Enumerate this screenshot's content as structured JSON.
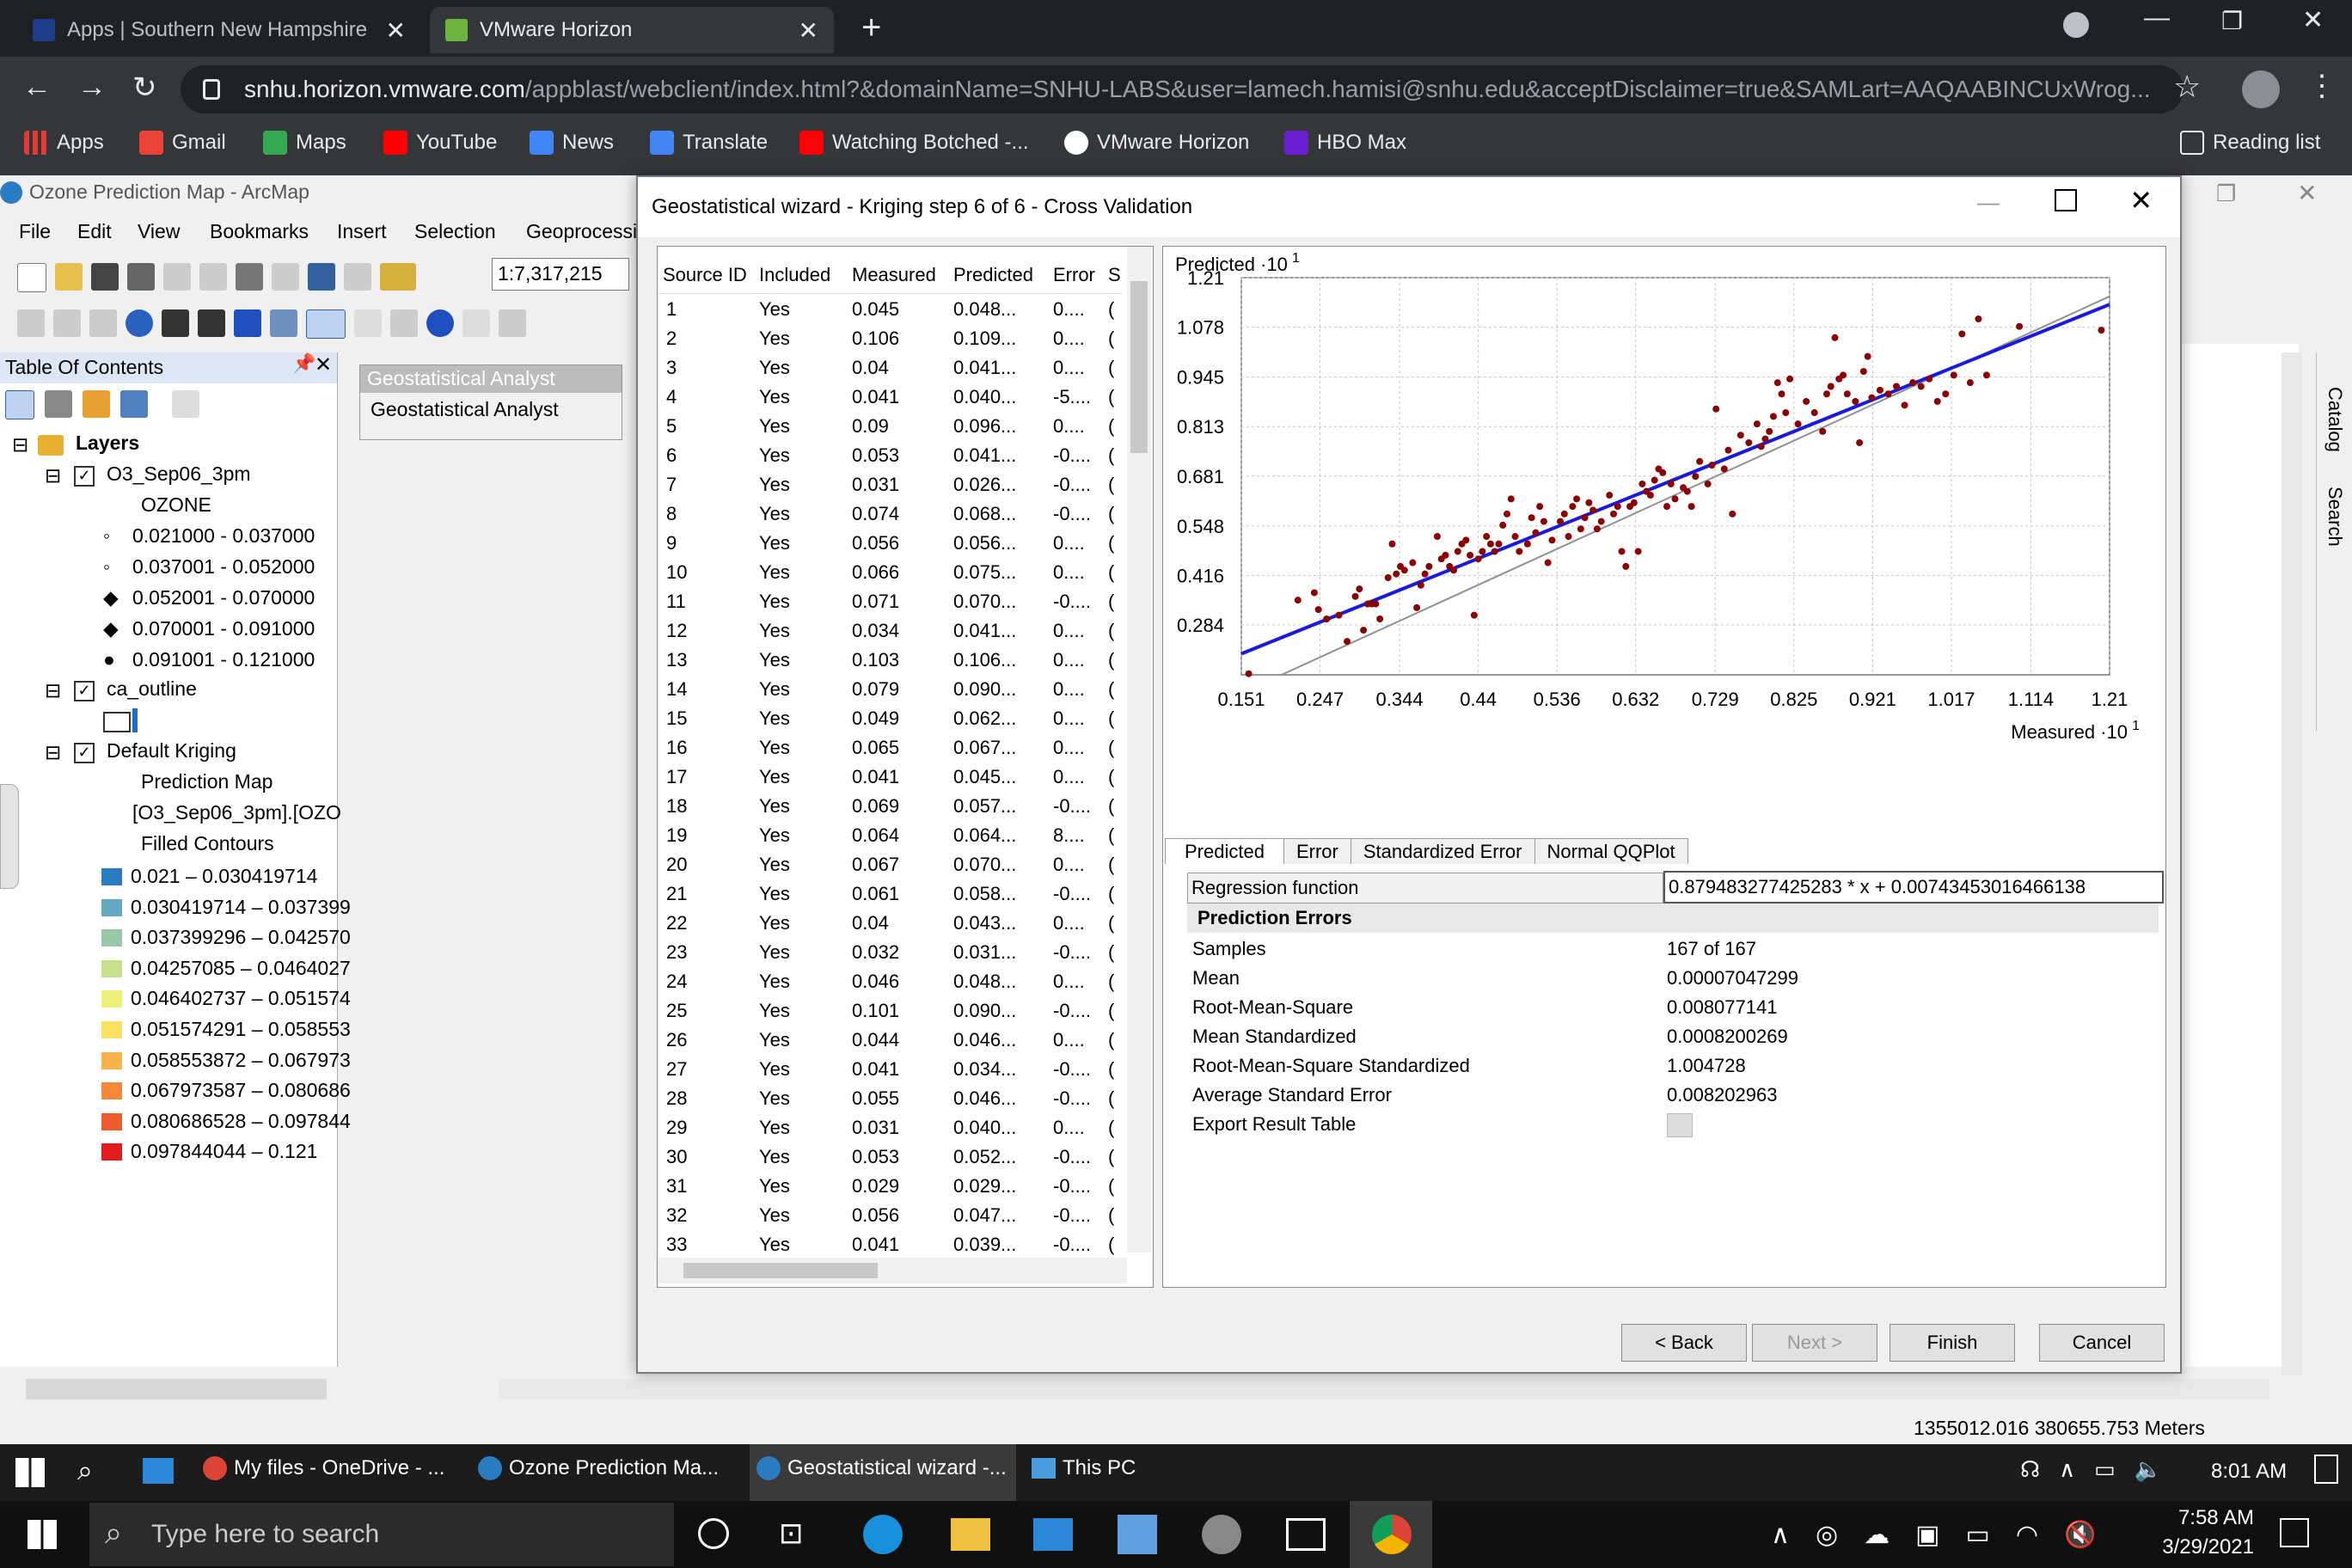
{
  "browser": {
    "tabs": [
      {
        "label": "Apps | Southern New Hampshire",
        "active": false
      },
      {
        "label": "VMware Horizon",
        "active": true
      }
    ],
    "url_host": "snhu.horizon.vmware.com",
    "url_path": "/appblast/webclient/index.html?&domainName=SNHU-LABS&user=lamech.hamisi@snhu.edu&acceptDisclaimer=true&SAMLart=AAQAABINCUxWrog...",
    "bookmarks": [
      "Apps",
      "Gmail",
      "Maps",
      "YouTube",
      "News",
      "Translate",
      "Watching Botched -...",
      "VMware Horizon",
      "HBO Max"
    ],
    "reading_list": "Reading list"
  },
  "arcmap": {
    "title": "Ozone Prediction Map - ArcMap",
    "menus": [
      "File",
      "Edit",
      "View",
      "Bookmarks",
      "Insert",
      "Selection",
      "Geoprocessi"
    ],
    "scale": "1:7,317,215",
    "toc_title": "Table Of Contents",
    "ga_toolbar_title": "Geostatistical Analyst",
    "ga_dropdown": "Geostatistical Analyst",
    "toc": {
      "layers_label": "Layers",
      "layer1": "O3_Sep06_3pm",
      "layer1_field": "OZONE",
      "layer1_classes": [
        "0.021000 - 0.037000",
        "0.037001 - 0.052000",
        "0.052001 - 0.070000",
        "0.070001 - 0.091000",
        "0.091001 - 0.121000"
      ],
      "layer2": "ca_outline",
      "layer3": "Default Kriging",
      "layer3_sub1": "Prediction Map",
      "layer3_sub2": "[O3_Sep06_3pm].[OZO",
      "layer3_sub3": "Filled Contours",
      "contours": [
        {
          "label": "0.021 – 0.030419714",
          "color": "#2a7bc0"
        },
        {
          "label": "0.030419714 – 0.037399",
          "color": "#64a8c4"
        },
        {
          "label": "0.037399296 – 0.042570",
          "color": "#98c8a8"
        },
        {
          "label": "0.04257085 – 0.0464027",
          "color": "#c6e08c"
        },
        {
          "label": "0.046402737 – 0.051574",
          "color": "#eef07a"
        },
        {
          "label": "0.051574291 – 0.058553",
          "color": "#fde060"
        },
        {
          "label": "0.058553872 – 0.067973",
          "color": "#fcb24a"
        },
        {
          "label": "0.067973587 – 0.080686",
          "color": "#f7883a"
        },
        {
          "label": "0.080686528 – 0.097844",
          "color": "#ef5a2a"
        },
        {
          "label": "0.097844044 – 0.121",
          "color": "#e01c1c"
        }
      ]
    },
    "coordinates": "1355012.016  380655.753 Meters"
  },
  "dialog": {
    "title": "Geostatistical wizard - Kriging step 6 of 6 - Cross Validation",
    "columns": [
      "Source ID",
      "Included",
      "Measured",
      "Predicted",
      "Error",
      "S"
    ],
    "rows": [
      [
        "1",
        "Yes",
        "0.045",
        "0.048...",
        "0...."
      ],
      [
        "2",
        "Yes",
        "0.106",
        "0.109...",
        "0...."
      ],
      [
        "3",
        "Yes",
        "0.04",
        "0.041...",
        "0...."
      ],
      [
        "4",
        "Yes",
        "0.041",
        "0.040...",
        "-5...."
      ],
      [
        "5",
        "Yes",
        "0.09",
        "0.096...",
        "0...."
      ],
      [
        "6",
        "Yes",
        "0.053",
        "0.041...",
        "-0...."
      ],
      [
        "7",
        "Yes",
        "0.031",
        "0.026...",
        "-0...."
      ],
      [
        "8",
        "Yes",
        "0.074",
        "0.068...",
        "-0...."
      ],
      [
        "9",
        "Yes",
        "0.056",
        "0.056...",
        "0...."
      ],
      [
        "10",
        "Yes",
        "0.066",
        "0.075...",
        "0...."
      ],
      [
        "11",
        "Yes",
        "0.071",
        "0.070...",
        "-0...."
      ],
      [
        "12",
        "Yes",
        "0.034",
        "0.041...",
        "0...."
      ],
      [
        "13",
        "Yes",
        "0.103",
        "0.106...",
        "0...."
      ],
      [
        "14",
        "Yes",
        "0.079",
        "0.090...",
        "0...."
      ],
      [
        "15",
        "Yes",
        "0.049",
        "0.062...",
        "0...."
      ],
      [
        "16",
        "Yes",
        "0.065",
        "0.067...",
        "0...."
      ],
      [
        "17",
        "Yes",
        "0.041",
        "0.045...",
        "0...."
      ],
      [
        "18",
        "Yes",
        "0.069",
        "0.057...",
        "-0...."
      ],
      [
        "19",
        "Yes",
        "0.064",
        "0.064...",
        "8...."
      ],
      [
        "20",
        "Yes",
        "0.067",
        "0.070...",
        "0...."
      ],
      [
        "21",
        "Yes",
        "0.061",
        "0.058...",
        "-0...."
      ],
      [
        "22",
        "Yes",
        "0.04",
        "0.043...",
        "0...."
      ],
      [
        "23",
        "Yes",
        "0.032",
        "0.031...",
        "-0...."
      ],
      [
        "24",
        "Yes",
        "0.046",
        "0.048...",
        "0...."
      ],
      [
        "25",
        "Yes",
        "0.101",
        "0.090...",
        "-0...."
      ],
      [
        "26",
        "Yes",
        "0.044",
        "0.046...",
        "0...."
      ],
      [
        "27",
        "Yes",
        "0.041",
        "0.034...",
        "-0...."
      ],
      [
        "28",
        "Yes",
        "0.055",
        "0.046...",
        "-0...."
      ],
      [
        "29",
        "Yes",
        "0.031",
        "0.040...",
        "0...."
      ],
      [
        "30",
        "Yes",
        "0.053",
        "0.052...",
        "-0...."
      ],
      [
        "31",
        "Yes",
        "0.029",
        "0.029...",
        "-0...."
      ],
      [
        "32",
        "Yes",
        "0.056",
        "0.047...",
        "-0...."
      ],
      [
        "33",
        "Yes",
        "0.041",
        "0.039...",
        "-0...."
      ]
    ],
    "tabs": [
      "Predicted",
      "Error",
      "Standardized Error",
      "Normal QQPlot"
    ],
    "regression_label": "Regression function",
    "regression_value": "0.879483277425283 * x + 0.00743453016466138",
    "errors_header": "Prediction Errors",
    "stats": [
      {
        "label": "Samples",
        "value": "167 of 167"
      },
      {
        "label": "Mean",
        "value": "0.00007047299"
      },
      {
        "label": "Root-Mean-Square",
        "value": "0.008077141"
      },
      {
        "label": "Mean Standardized",
        "value": "0.0008200269"
      },
      {
        "label": "Root-Mean-Square Standardized",
        "value": "1.004728"
      },
      {
        "label": "Average Standard Error",
        "value": "0.008202963"
      },
      {
        "label": "Export Result Table",
        "value": ""
      }
    ],
    "buttons": {
      "back": "< Back",
      "next": "Next >",
      "finish": "Finish",
      "cancel": "Cancel"
    }
  },
  "chart_data": {
    "type": "scatter",
    "ylabel": "Predicted ·10",
    "xlabel": "Measured ·10",
    "label_exponent": "1",
    "xlim": [
      0.151,
      1.21
    ],
    "ylim": [
      0.151,
      1.21
    ],
    "xticks": [
      "0.151",
      "0.247",
      "0.344",
      "0.44",
      "0.536",
      "0.632",
      "0.729",
      "0.825",
      "0.921",
      "1.017",
      "1.114",
      "1.21"
    ],
    "yticks": [
      "1.21",
      "1.078",
      "0.945",
      "0.813",
      "0.681",
      "0.548",
      "0.416",
      "0.284"
    ],
    "regression": {
      "slope": 0.879483277425283,
      "intercept": 0.0743453016466138,
      "color": "#1a1adf"
    },
    "reference_line_color": "#909090",
    "point_color": "#8b0000",
    "points": [
      [
        0.16,
        0.154
      ],
      [
        0.22,
        0.35
      ],
      [
        0.24,
        0.37
      ],
      [
        0.245,
        0.325
      ],
      [
        0.255,
        0.3
      ],
      [
        0.27,
        0.31
      ],
      [
        0.28,
        0.24
      ],
      [
        0.29,
        0.36
      ],
      [
        0.295,
        0.38
      ],
      [
        0.3,
        0.27
      ],
      [
        0.305,
        0.34
      ],
      [
        0.31,
        0.34
      ],
      [
        0.315,
        0.34
      ],
      [
        0.32,
        0.3
      ],
      [
        0.33,
        0.41
      ],
      [
        0.335,
        0.5
      ],
      [
        0.34,
        0.42
      ],
      [
        0.345,
        0.44
      ],
      [
        0.35,
        0.43
      ],
      [
        0.36,
        0.45
      ],
      [
        0.365,
        0.33
      ],
      [
        0.37,
        0.39
      ],
      [
        0.375,
        0.42
      ],
      [
        0.38,
        0.44
      ],
      [
        0.39,
        0.52
      ],
      [
        0.395,
        0.46
      ],
      [
        0.4,
        0.47
      ],
      [
        0.405,
        0.44
      ],
      [
        0.41,
        0.43
      ],
      [
        0.415,
        0.48
      ],
      [
        0.42,
        0.5
      ],
      [
        0.425,
        0.51
      ],
      [
        0.43,
        0.47
      ],
      [
        0.435,
        0.31
      ],
      [
        0.44,
        0.46
      ],
      [
        0.445,
        0.48
      ],
      [
        0.45,
        0.52
      ],
      [
        0.455,
        0.5
      ],
      [
        0.46,
        0.48
      ],
      [
        0.465,
        0.5
      ],
      [
        0.47,
        0.55
      ],
      [
        0.475,
        0.58
      ],
      [
        0.48,
        0.62
      ],
      [
        0.485,
        0.52
      ],
      [
        0.49,
        0.48
      ],
      [
        0.5,
        0.5
      ],
      [
        0.505,
        0.57
      ],
      [
        0.51,
        0.53
      ],
      [
        0.515,
        0.6
      ],
      [
        0.52,
        0.56
      ],
      [
        0.525,
        0.45
      ],
      [
        0.53,
        0.51
      ],
      [
        0.54,
        0.56
      ],
      [
        0.545,
        0.58
      ],
      [
        0.55,
        0.52
      ],
      [
        0.555,
        0.6
      ],
      [
        0.56,
        0.62
      ],
      [
        0.565,
        0.54
      ],
      [
        0.57,
        0.57
      ],
      [
        0.575,
        0.61
      ],
      [
        0.58,
        0.59
      ],
      [
        0.585,
        0.54
      ],
      [
        0.59,
        0.56
      ],
      [
        0.6,
        0.63
      ],
      [
        0.605,
        0.58
      ],
      [
        0.61,
        0.6
      ],
      [
        0.615,
        0.48
      ],
      [
        0.62,
        0.44
      ],
      [
        0.625,
        0.6
      ],
      [
        0.63,
        0.61
      ],
      [
        0.635,
        0.48
      ],
      [
        0.64,
        0.66
      ],
      [
        0.645,
        0.64
      ],
      [
        0.65,
        0.63
      ],
      [
        0.655,
        0.67
      ],
      [
        0.66,
        0.7
      ],
      [
        0.665,
        0.69
      ],
      [
        0.67,
        0.6
      ],
      [
        0.675,
        0.66
      ],
      [
        0.68,
        0.62
      ],
      [
        0.69,
        0.65
      ],
      [
        0.695,
        0.64
      ],
      [
        0.7,
        0.6
      ],
      [
        0.705,
        0.68
      ],
      [
        0.71,
        0.72
      ],
      [
        0.72,
        0.66
      ],
      [
        0.725,
        0.71
      ],
      [
        0.73,
        0.86
      ],
      [
        0.74,
        0.7
      ],
      [
        0.745,
        0.75
      ],
      [
        0.75,
        0.58
      ],
      [
        0.76,
        0.79
      ],
      [
        0.77,
        0.77
      ],
      [
        0.78,
        0.82
      ],
      [
        0.785,
        0.76
      ],
      [
        0.79,
        0.78
      ],
      [
        0.795,
        0.8
      ],
      [
        0.8,
        0.84
      ],
      [
        0.805,
        0.93
      ],
      [
        0.81,
        0.9
      ],
      [
        0.815,
        0.85
      ],
      [
        0.82,
        0.94
      ],
      [
        0.83,
        0.82
      ],
      [
        0.84,
        0.88
      ],
      [
        0.85,
        0.85
      ],
      [
        0.86,
        0.8
      ],
      [
        0.865,
        0.9
      ],
      [
        0.87,
        0.92
      ],
      [
        0.875,
        1.05
      ],
      [
        0.88,
        0.94
      ],
      [
        0.885,
        0.95
      ],
      [
        0.89,
        0.9
      ],
      [
        0.9,
        0.88
      ],
      [
        0.905,
        0.77
      ],
      [
        0.91,
        0.96
      ],
      [
        0.915,
        1.0
      ],
      [
        0.92,
        0.89
      ],
      [
        0.93,
        0.91
      ],
      [
        0.94,
        0.9
      ],
      [
        0.95,
        0.92
      ],
      [
        0.96,
        0.87
      ],
      [
        0.97,
        0.93
      ],
      [
        0.98,
        0.92
      ],
      [
        0.99,
        0.94
      ],
      [
        1.0,
        0.88
      ],
      [
        1.01,
        0.9
      ],
      [
        1.02,
        0.95
      ],
      [
        1.03,
        1.06
      ],
      [
        1.04,
        0.93
      ],
      [
        1.05,
        1.1
      ],
      [
        1.06,
        0.95
      ],
      [
        1.1,
        1.08
      ],
      [
        1.2,
        1.07
      ]
    ]
  },
  "taskbar_vm": {
    "items": [
      "My files - OneDrive - ...",
      "Ozone Prediction Ma...",
      "Geostatistical wizard -...",
      "This PC"
    ],
    "time": "8:01 AM"
  },
  "taskbar_host": {
    "search_placeholder": "Type here to search",
    "time": "7:58 AM",
    "date": "3/29/2021"
  }
}
